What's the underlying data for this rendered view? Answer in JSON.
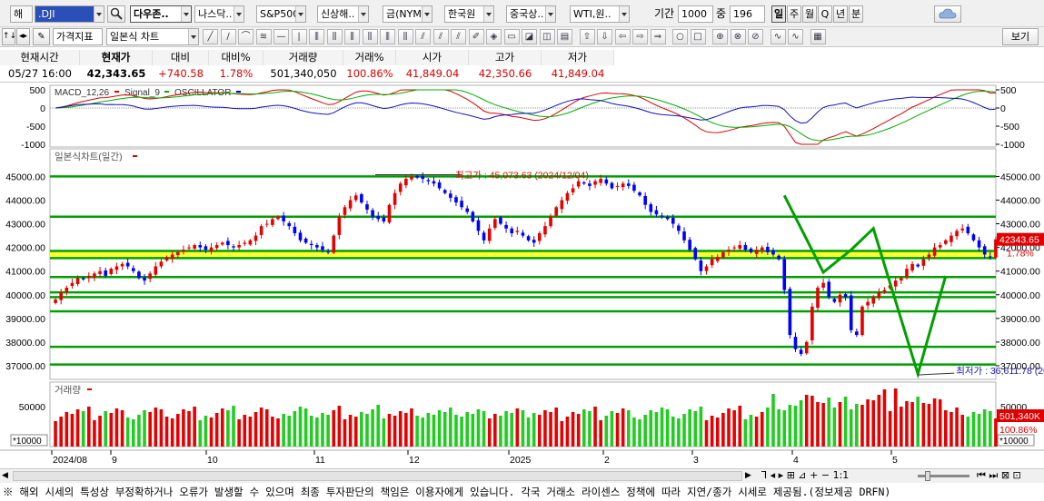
{
  "toolbar": {
    "market_label": "해",
    "symbol_value": ".DJI",
    "index_selected": "다우존..",
    "index_buttons": [
      "나스닥..",
      "S&P500",
      "신상해..",
      "금(NYM..",
      "한국원",
      "중국상..",
      "WTI,원.."
    ],
    "period_label": "기간",
    "period_value": "1000",
    "count_label": "중",
    "count_value": "196",
    "timeframes": [
      "일",
      "주",
      "월",
      "Q",
      "년",
      "분"
    ],
    "active_timeframe": "일"
  },
  "toolbar2": {
    "price_indicator": "가격지표",
    "chart_type": "일본식 차트",
    "view_button": "보기"
  },
  "info": {
    "headers": [
      "현재시간",
      "현재가",
      "대비",
      "대비%",
      "거래량",
      "거래%",
      "시가",
      "고가",
      "저가"
    ],
    "time": "05/27  16:00",
    "price": "42,343.65",
    "change": "+740.58",
    "change_pct": "1.78%",
    "volume": "501,340,050",
    "volume_pct": "100.86%",
    "open": "41,849.04",
    "high": "42,350.66",
    "low": "41,849.04"
  },
  "macd": {
    "label_macd": "MACD_12,26",
    "label_signal": "Signal_9",
    "label_osc": "OSCILLATOR",
    "ticks": [
      "500",
      "0",
      "-500",
      "-1000"
    ]
  },
  "price_panel": {
    "title": "일본식차트(일간)",
    "ticks": [
      "45000.00",
      "44000.00",
      "43000.00",
      "42000.00",
      "41000.00",
      "40000.00",
      "39000.00",
      "38000.00",
      "37000.00"
    ],
    "current_label": "42343.65",
    "current_pct": "1.78%",
    "high_annotation": "최고가 : 45,073.63 (2024/12/04)",
    "low_annotation": "최저가 : 36,611.78 (2025/04/07)"
  },
  "volume_panel": {
    "title": "거래량",
    "tick": "50000",
    "unit": "*10000",
    "current_label": "501,340K",
    "current_pct": "100.86%"
  },
  "x_axis": {
    "labels": [
      "2024/08",
      "9",
      "10",
      "11",
      "12",
      "2025",
      "2",
      "3",
      "4",
      "5"
    ]
  },
  "scrollbar": {
    "ratio_label": "1:1"
  },
  "notice": "※ 해외 시세의 특성상 부정확하거나 오류가 발생할 수 있으며 최종 투자판단의 책임은 이용자에게 있습니다. 각국 거래소 라이센스 정책에 따라 지연/종가 시세로 제공됨.(정보제공 DRFN)",
  "chart_data": {
    "type": "candlestick",
    "title": "일본식차트(일간)",
    "symbol": ".DJI",
    "x_labels": [
      "2024/08",
      "9",
      "10",
      "11",
      "12",
      "2025",
      "2",
      "3",
      "4",
      "5"
    ],
    "y_range": [
      36500,
      45400
    ],
    "y_ticks": [
      45000,
      44000,
      43000,
      42000,
      41000,
      40000,
      39000,
      38000,
      37000
    ],
    "support_resistance_lines": [
      45000,
      43300,
      41850,
      41550,
      40750,
      40100,
      39900,
      39300,
      37800,
      37050
    ],
    "highlight_band": [
      41600,
      41850
    ],
    "close_approx": [
      39800,
      40100,
      40300,
      40500,
      40700,
      40650,
      40800,
      40900,
      41000,
      40800,
      41100,
      41200,
      41300,
      41200,
      41000,
      40700,
      40600,
      40900,
      41200,
      41400,
      41600,
      41700,
      41800,
      41900,
      42000,
      42100,
      42000,
      41900,
      42000,
      42100,
      42200,
      42100,
      42000,
      42100,
      42200,
      42300,
      42500,
      42900,
      43000,
      43200,
      43300,
      43100,
      42900,
      42600,
      42300,
      42200,
      42100,
      42000,
      41900,
      41800,
      42500,
      43300,
      43700,
      44000,
      44200,
      43900,
      43600,
      43300,
      43200,
      43100,
      43800,
      44300,
      44700,
      44900,
      45000,
      44950,
      44900,
      44800,
      44700,
      44500,
      44300,
      44100,
      43900,
      43700,
      43500,
      43100,
      42700,
      42300,
      42800,
      43200,
      43000,
      42800,
      42600,
      42700,
      42500,
      42300,
      42200,
      42600,
      42900,
      43300,
      43700,
      44000,
      44300,
      44500,
      44800,
      44700,
      44600,
      44800,
      44900,
      44700,
      44500,
      44600,
      44700,
      44600,
      44400,
      44200,
      43800,
      43500,
      43400,
      43300,
      43200,
      43000,
      42700,
      42300,
      41900,
      41500,
      41000,
      41200,
      41500,
      41600,
      41800,
      41900,
      42000,
      42100,
      41900,
      41800,
      41900,
      42000,
      41800,
      41700,
      41500,
      40200,
      38300,
      37700,
      37500,
      38000,
      39500,
      40300,
      40500,
      39900,
      39700,
      40000,
      39900,
      38500,
      38300,
      39500,
      39700,
      39900,
      40100,
      40200,
      40400,
      40600,
      40700,
      41100,
      41300,
      41200,
      41500,
      41700,
      42000,
      42100,
      42300,
      42500,
      42700,
      42800,
      42600,
      42300,
      42000,
      41700,
      41600,
      42343.65
    ],
    "annotations": [
      {
        "text": "최고가 : 45,073.63 (2024/12/04)",
        "value": 45073.63
      },
      {
        "text": "최저가 : 36,611.78 (2025/04/07)",
        "value": 36611.78
      }
    ],
    "current": {
      "value": 42343.65,
      "change_pct": "1.78%"
    },
    "volume": {
      "unit": "*10000",
      "tick": 50000,
      "current": "501,340K",
      "current_pct": "100.86%"
    },
    "macd_range": [
      -1000,
      500
    ],
    "colors": {
      "up": "#e60000",
      "down": "#0000ff",
      "lines": "#00a000",
      "highlight": "#ffff33"
    }
  }
}
